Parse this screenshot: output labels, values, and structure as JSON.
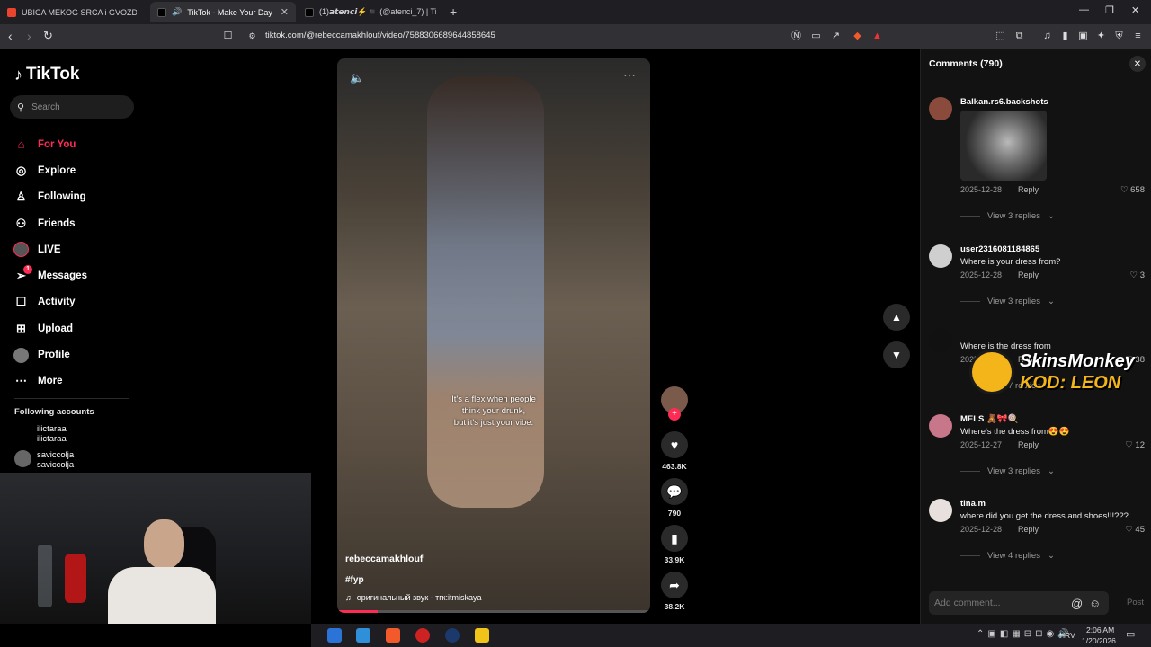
{
  "tabs": [
    {
      "title": "UBICA MEKOG SRCA i GVOZDENE PE"
    },
    {
      "title": "TikTok - Make Your Day"
    },
    {
      "title": "(1)𝙖𝙩𝙚𝙣𝙘𝙞⚡◾ (@atenci_7) | TikTok"
    }
  ],
  "address": {
    "url": "tiktok.com/@rebeccamakhlouf/video/7588306689644858645"
  },
  "sidebar": {
    "logo": "TikTok",
    "search_placeholder": "Search",
    "nav": [
      {
        "label": "For You",
        "icon": "home-icon"
      },
      {
        "label": "Explore",
        "icon": "compass-icon"
      },
      {
        "label": "Following",
        "icon": "following-icon"
      },
      {
        "label": "Friends",
        "icon": "friends-icon"
      },
      {
        "label": "LIVE",
        "icon": "live-icon"
      },
      {
        "label": "Messages",
        "icon": "messages-icon",
        "badge": "1"
      },
      {
        "label": "Activity",
        "icon": "activity-icon"
      },
      {
        "label": "Upload",
        "icon": "upload-icon"
      },
      {
        "label": "Profile",
        "icon": "profile-icon"
      },
      {
        "label": "More",
        "icon": "more-icon"
      }
    ],
    "following_title": "Following accounts",
    "following": [
      {
        "name": "ilictaraa",
        "handle": "ilictaraa"
      },
      {
        "name": "saviccolja",
        "handle": "saviccolja"
      }
    ]
  },
  "video": {
    "caption_lines": [
      "It's a flex when people",
      "think your drunk,",
      "but it's just your vibe."
    ],
    "author": "rebeccamakhlouf",
    "hashtag": "#fyp",
    "sound": "оригинальный звук - тгк:itmiskaya"
  },
  "actions": {
    "likes": "463.8K",
    "comments": "790",
    "saves": "33.9K",
    "shares": "38.2K"
  },
  "comments_panel": {
    "title": "Comments (790)",
    "items": [
      {
        "user": "Balkan.rs6.backshots",
        "text": "",
        "date": "2025-12-28",
        "reply": "Reply",
        "likes": "658",
        "view_replies": "View 3 replies"
      },
      {
        "user": "user2316081184865",
        "text": "Where is your dress from?",
        "date": "2025-12-28",
        "reply": "Reply",
        "likes": "3",
        "view_replies": "View 3 replies"
      },
      {
        "user": "",
        "text": "Where is the dress from",
        "date": "2025-12-27",
        "reply": "Reply",
        "likes": "38",
        "view_replies": "View 7 replies"
      },
      {
        "user": "MELS 🧸🎀🍭",
        "text": "Where's the dress from😍😍",
        "date": "2025-12-27",
        "reply": "Reply",
        "likes": "12",
        "view_replies": "View 3 replies"
      },
      {
        "user": "tina.m",
        "text": "where did you get the dress and shoes!!!???",
        "date": "2025-12-28",
        "reply": "Reply",
        "likes": "45",
        "view_replies": "View 4 replies"
      }
    ],
    "add_placeholder": "Add comment...",
    "post_label": "Post"
  },
  "promo": {
    "line1": "SkinsMonkey",
    "line2": "KOD: LEON"
  },
  "taskbar": {
    "lang": "HRV",
    "time": "2:06 AM",
    "date": "1/20/2026"
  },
  "colors": {
    "accent": "#fe2c55",
    "panel": "#121212",
    "chrome": "#1f1f23"
  }
}
